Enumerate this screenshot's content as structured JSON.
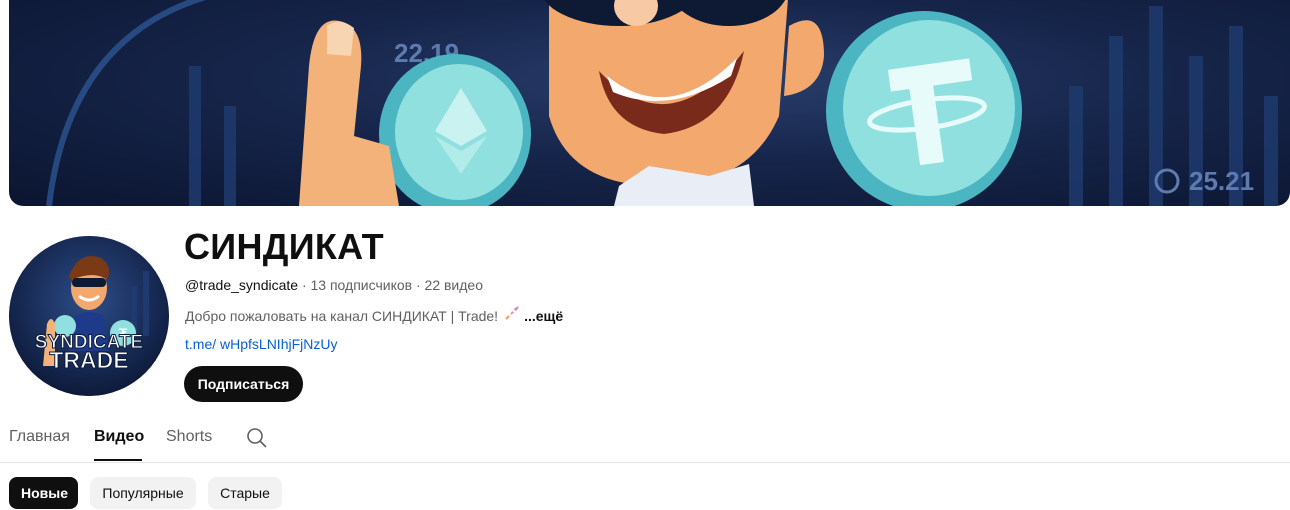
{
  "channel": {
    "title": "СИНДИКАТ",
    "handle": "@trade_syndicate",
    "subscribers": "13 подписчиков",
    "videos": "22 видео",
    "separator": " · ",
    "description": "Добро пожаловать на канал СИНДИКАТ | Trade!",
    "description_emoji": "rocket-emoji",
    "more_label": "...ещё",
    "link": "t.me/ wHpfsLNIhjFjNzUy",
    "subscribe_label": "Подписаться"
  },
  "banner": {
    "price_left": "22.19",
    "price_right": "25.21",
    "icons": [
      "ethereum-coin-icon",
      "tether-coin-icon"
    ]
  },
  "avatar": {
    "line1": "SYNDICATE",
    "line2": "TRADE"
  },
  "tabs": [
    {
      "label": "Главная",
      "active": false
    },
    {
      "label": "Видео",
      "active": true
    },
    {
      "label": "Shorts",
      "active": false
    }
  ],
  "search_icon": "search-icon",
  "chips": [
    {
      "label": "Новые",
      "active": true
    },
    {
      "label": "Популярные",
      "active": false
    },
    {
      "label": "Старые",
      "active": false
    }
  ],
  "colors": {
    "link": "#065fd4",
    "subscribe_bg": "#0f0f0f",
    "banner_bg": "#16254a",
    "coin": "#7ed8d6"
  }
}
